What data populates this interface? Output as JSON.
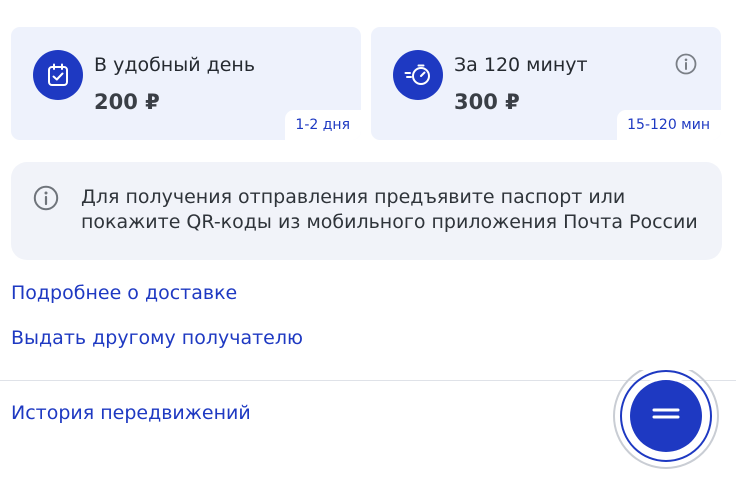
{
  "cards": [
    {
      "icon": "calendar-check-icon",
      "title": "В удобный день",
      "price": "200 ₽",
      "badge": "1-2 дня"
    },
    {
      "icon": "fast-stopwatch-icon",
      "title": "За 120 минут",
      "price": "300 ₽",
      "badge": "15-120 мин",
      "info_icon": "info-icon"
    }
  ],
  "notice": {
    "icon": "info-icon",
    "text": "Для получения отправления предъявите паспорт или покажите QR-коды из мобильного приложения Почта России"
  },
  "links": {
    "delivery_details": "Подробнее о доставке",
    "other_recipient": "Выдать другому получателю",
    "tracking_history": "История передвижений"
  },
  "fab": {
    "icon": "chat-menu-icon"
  },
  "colors": {
    "accent": "#1e39c2",
    "card_bg": "#eef2fc",
    "notice_bg": "#f1f3f9",
    "text": "#252a30"
  }
}
